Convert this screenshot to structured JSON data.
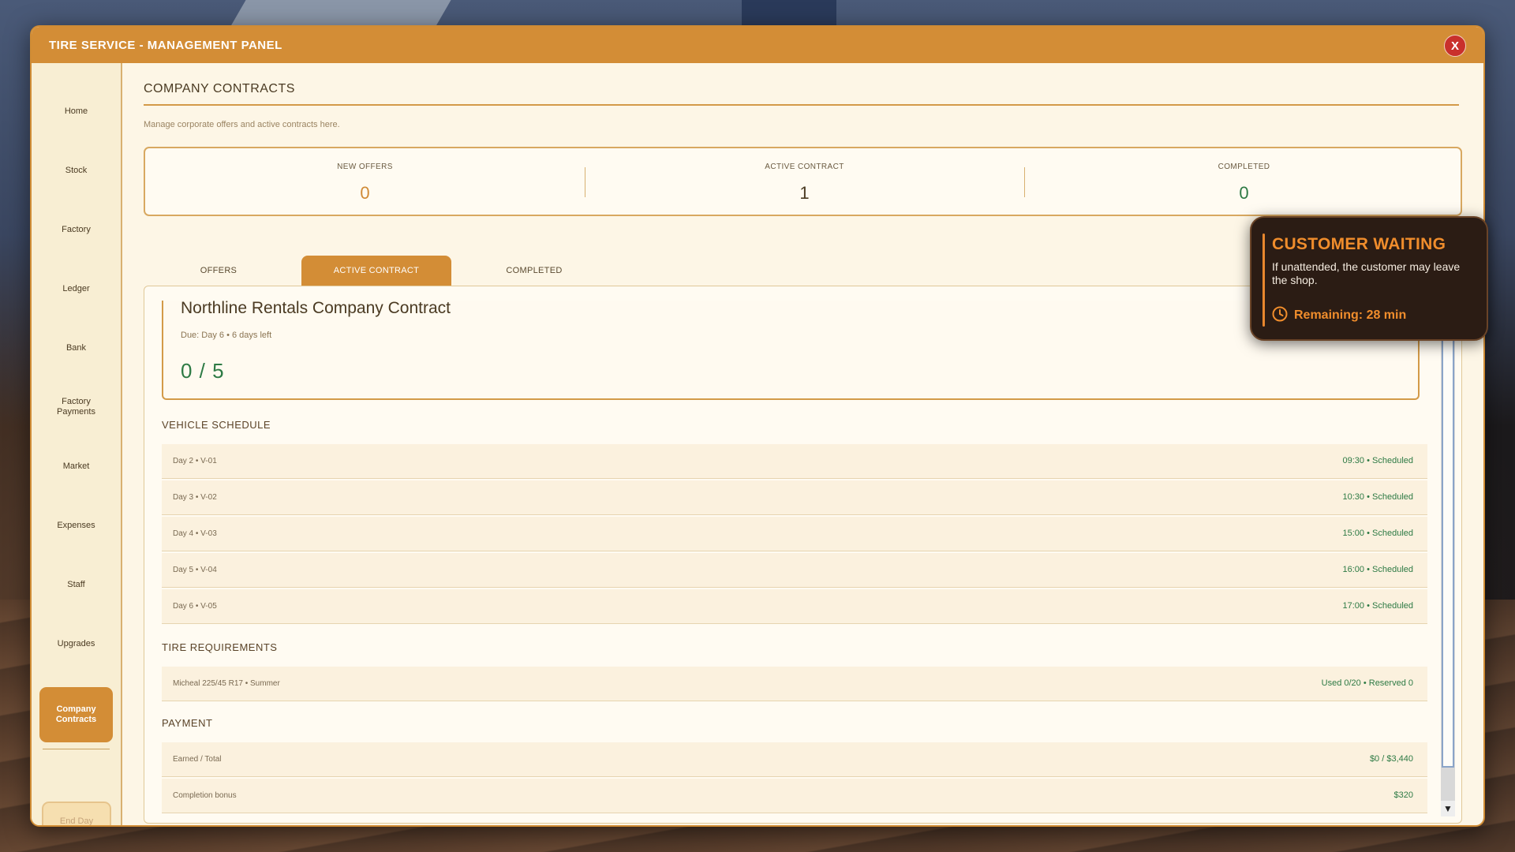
{
  "window": {
    "title": "TIRE SERVICE - MANAGEMENT PANEL",
    "close_label": "X"
  },
  "sidebar": {
    "items": [
      {
        "label": "Home"
      },
      {
        "label": "Stock"
      },
      {
        "label": "Factory"
      },
      {
        "label": "Ledger"
      },
      {
        "label": "Bank"
      },
      {
        "label": "Factory Payments"
      },
      {
        "label": "Market"
      },
      {
        "label": "Expenses"
      },
      {
        "label": "Staff"
      },
      {
        "label": "Upgrades"
      },
      {
        "label": "Company Contracts"
      }
    ],
    "active": "Company Contracts",
    "end_day_label": "End Day"
  },
  "page": {
    "title": "COMPANY CONTRACTS",
    "subtitle": "Manage corporate offers and active contracts here."
  },
  "stats": [
    {
      "label": "NEW OFFERS",
      "value": "0",
      "color": "#d08a36"
    },
    {
      "label": "ACTIVE CONTRACT",
      "value": "1",
      "color": "#4a3a22"
    },
    {
      "label": "COMPLETED",
      "value": "0",
      "color": "#2d7a44"
    }
  ],
  "tabs": [
    {
      "label": "OFFERS"
    },
    {
      "label": "ACTIVE CONTRACT"
    },
    {
      "label": "COMPLETED"
    }
  ],
  "active_tab": "ACTIVE CONTRACT",
  "contract": {
    "name": "Northline Rentals Company Contract",
    "due": "Due: Day 6 • 6 days left",
    "progress": "0 / 5"
  },
  "vehicle_schedule": {
    "title": "VEHICLE SCHEDULE",
    "rows": [
      {
        "left": "Day 2 • V-01",
        "right": "09:30 • Scheduled"
      },
      {
        "left": "Day 3 • V-02",
        "right": "10:30 • Scheduled"
      },
      {
        "left": "Day 4 • V-03",
        "right": "15:00 • Scheduled"
      },
      {
        "left": "Day 5 • V-04",
        "right": "16:00 • Scheduled"
      },
      {
        "left": "Day 6 • V-05",
        "right": "17:00 • Scheduled"
      }
    ]
  },
  "tire_requirements": {
    "title": "TIRE REQUIREMENTS",
    "rows": [
      {
        "left": "Micheal 225/45 R17 • Summer",
        "right": "Used 0/20 • Reserved 0"
      }
    ]
  },
  "payment": {
    "title": "PAYMENT",
    "rows": [
      {
        "left": "Earned / Total",
        "right": "$0 / $3,440"
      },
      {
        "left": "Completion bonus",
        "right": "$320"
      }
    ]
  },
  "notification": {
    "title": "CUSTOMER WAITING",
    "message": "If unattended, the customer may leave the shop.",
    "remaining": "Remaining: 28 min",
    "icon": "clock-icon"
  },
  "colors": {
    "accent": "#d38d36",
    "success": "#2d7a44",
    "danger": "#c9302c"
  }
}
